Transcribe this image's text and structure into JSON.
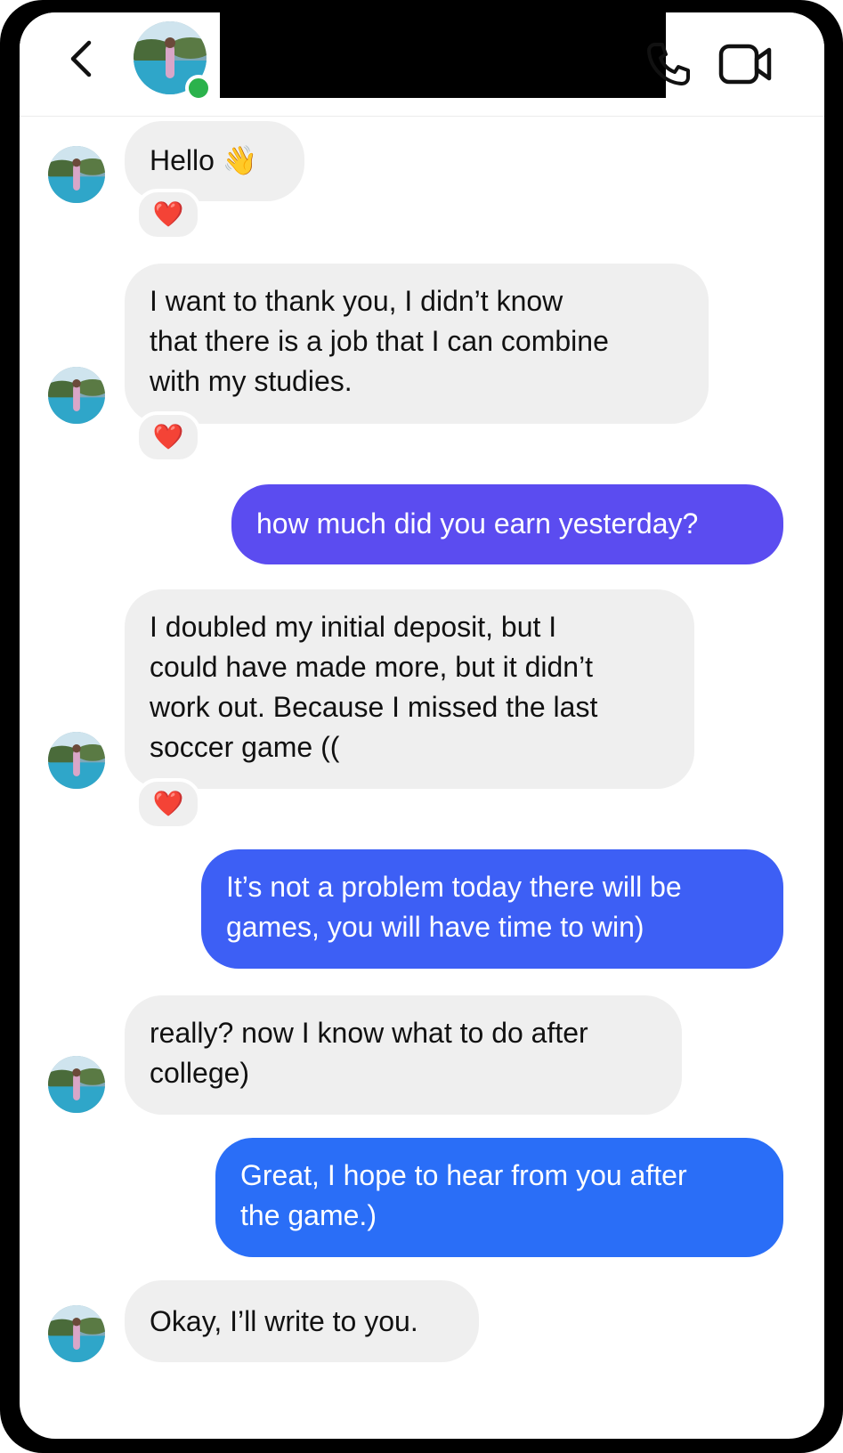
{
  "header": {
    "back_icon": "chevron-left-icon",
    "online_color": "#2bb24c",
    "call_icon": "phone-icon",
    "video_icon": "video-camera-icon"
  },
  "messages": [
    {
      "direction": "in",
      "text_lines": [
        "Hello 👋"
      ],
      "reaction": "❤️"
    },
    {
      "direction": "in",
      "text_lines": [
        "I want to thank you, I didn’t know",
        "that there is a job that I can combine",
        "with my studies."
      ],
      "reaction": "❤️"
    },
    {
      "direction": "out",
      "text_lines": [
        "how much did you earn yesterday?"
      ],
      "color": "#5b4cf0"
    },
    {
      "direction": "in",
      "text_lines": [
        "I doubled my initial deposit, but I",
        "could have made more, but it didn’t",
        "work out. Because I missed the last",
        "soccer game (("
      ],
      "reaction": "❤️"
    },
    {
      "direction": "out",
      "text_lines": [
        "It’s not a problem today there will be",
        "games, you will have time to win)"
      ],
      "color": "#3d5ff5"
    },
    {
      "direction": "in",
      "text_lines": [
        "really? now I know what to do after",
        "college)"
      ]
    },
    {
      "direction": "out",
      "text_lines": [
        "Great, I hope to hear from you after",
        "the game.)"
      ],
      "color": "#2a6ef7"
    },
    {
      "direction": "in",
      "text_lines": [
        "Okay, I’ll write to you."
      ]
    }
  ],
  "colors": {
    "incoming_bubble": "#efefef",
    "frame": "#000000"
  }
}
